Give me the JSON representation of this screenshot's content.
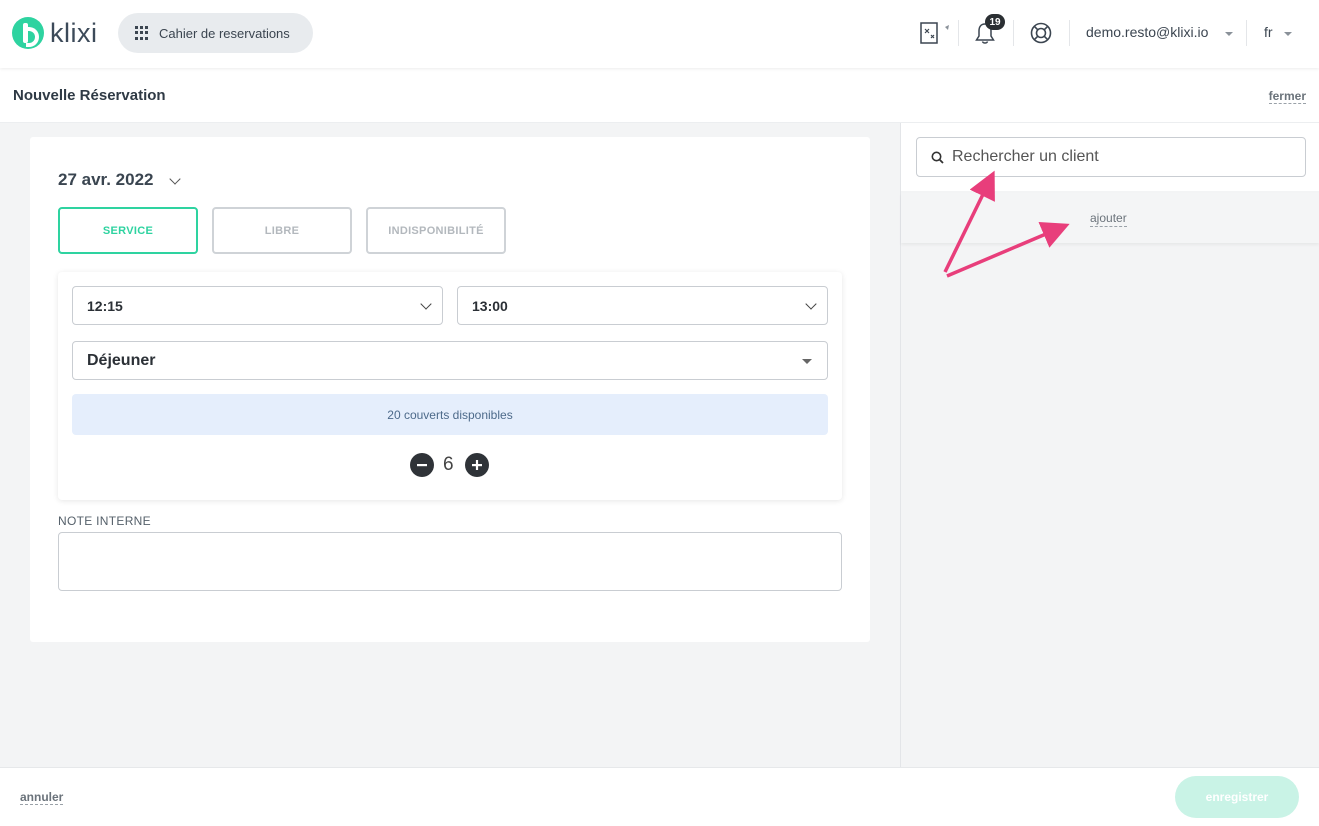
{
  "header": {
    "logo_text": "klixi",
    "app_switcher_label": "Cahier de reservations",
    "notification_count": "19",
    "user_email": "demo.resto@klixi.io",
    "language": "fr"
  },
  "subheader": {
    "title": "Nouvelle Réservation",
    "close_label": "fermer"
  },
  "form": {
    "date": "27 avr. 2022",
    "types": [
      "SERVICE",
      "LIBRE",
      "INDISPONIBILITÉ"
    ],
    "active_type": "SERVICE",
    "start_time": "12:15",
    "end_time": "13:00",
    "service": "Déjeuner",
    "availability": "20 couverts disponibles",
    "covers": "6",
    "note_label": "NOTE INTERNE",
    "note_value": ""
  },
  "client_panel": {
    "search_placeholder": "Rechercher un client",
    "add_label": "ajouter"
  },
  "footer": {
    "cancel_label": "annuler",
    "save_label": "enregistrer"
  },
  "colors": {
    "accent": "#2ed3a0",
    "annotation_arrow": "#e83e7b"
  }
}
